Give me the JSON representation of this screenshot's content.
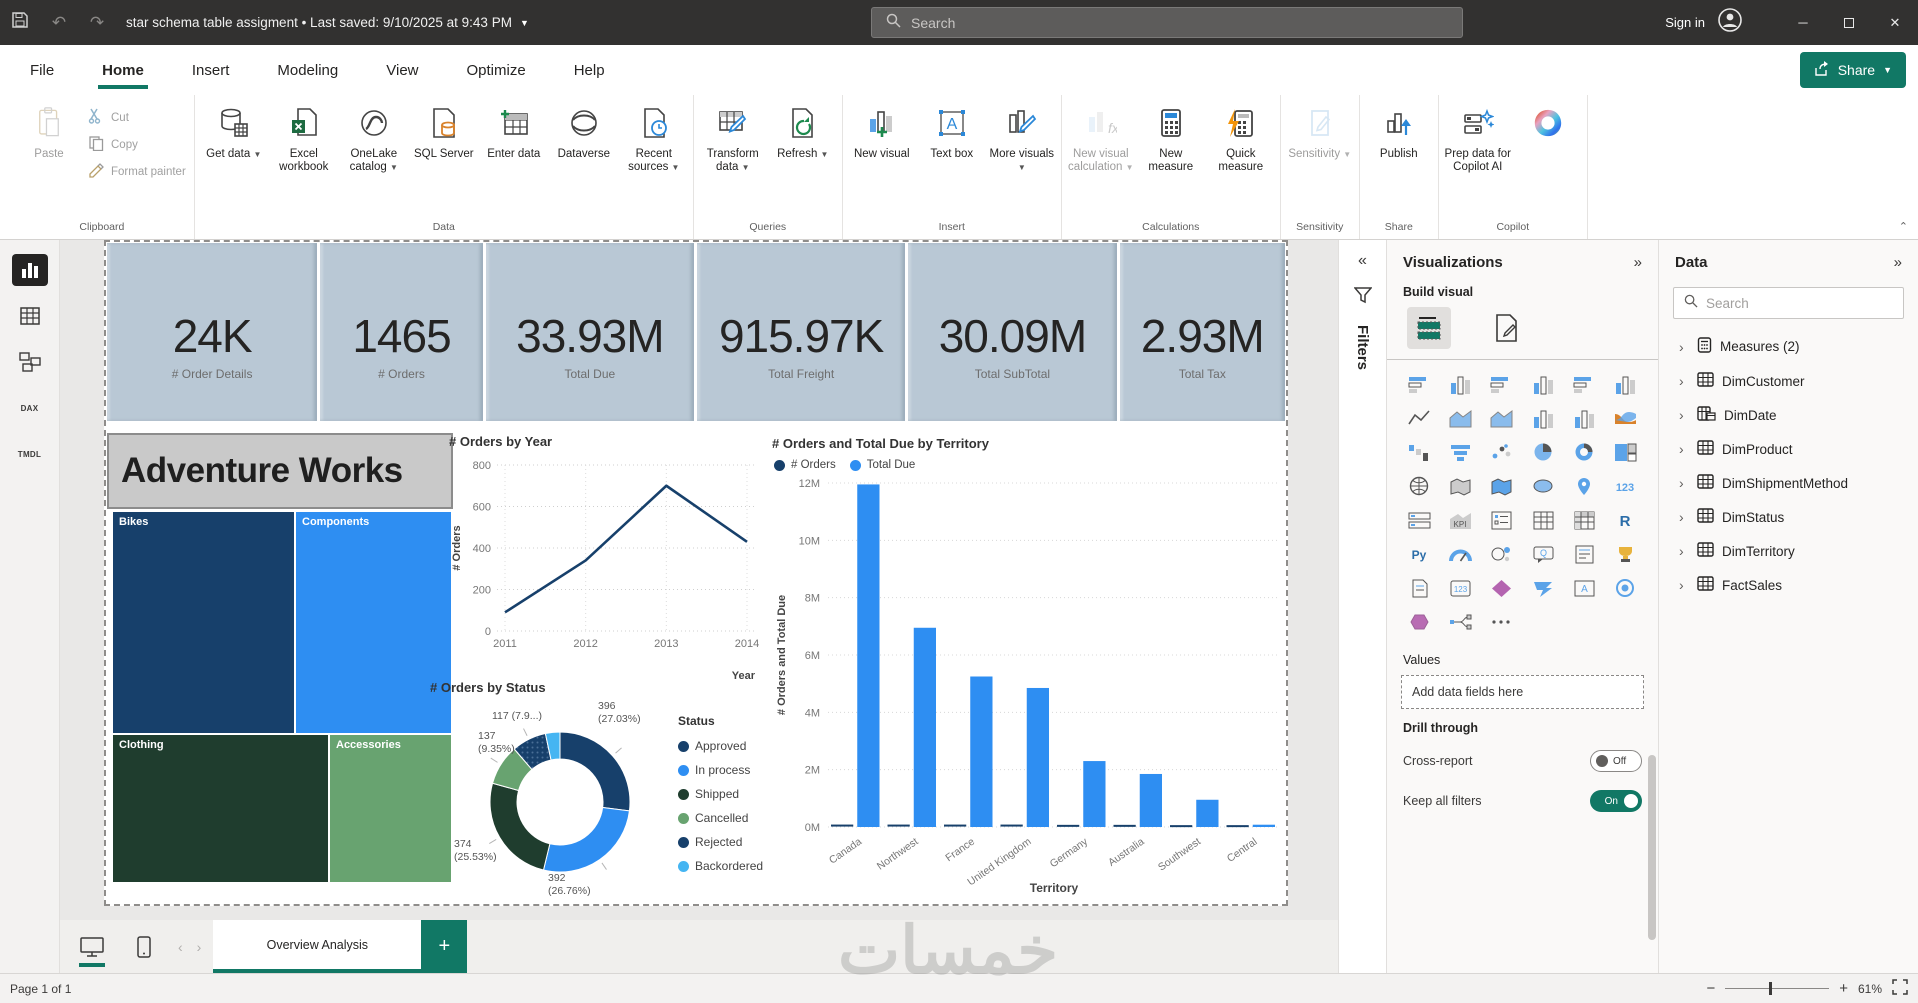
{
  "titlebar": {
    "title": "star schema table assigment  •  Last saved: 9/10/2025 at 9:43 PM",
    "search_placeholder": "Search",
    "sign_in": "Sign in"
  },
  "menubar": {
    "items": [
      "File",
      "Home",
      "Insert",
      "Modeling",
      "View",
      "Optimize",
      "Help"
    ],
    "active": "Home",
    "share_label": "Share"
  },
  "ribbon": {
    "groups": [
      {
        "label": "Clipboard",
        "layout": "clipboard",
        "buttons": [
          {
            "label": "Paste",
            "icon": "paste",
            "disabled": true
          },
          {
            "label": "Cut",
            "icon": "cut",
            "disabled": true
          },
          {
            "label": "Copy",
            "icon": "copy",
            "disabled": true
          },
          {
            "label": "Format painter",
            "icon": "format-painter",
            "disabled": true
          }
        ]
      },
      {
        "label": "Data",
        "buttons": [
          {
            "label": "Get data",
            "icon": "get-data",
            "caret": true
          },
          {
            "label": "Excel workbook",
            "icon": "excel-workbook"
          },
          {
            "label": "OneLake catalog",
            "icon": "onelake-catalog",
            "caret": true
          },
          {
            "label": "SQL Server",
            "icon": "sql-server"
          },
          {
            "label": "Enter data",
            "icon": "enter-data"
          },
          {
            "label": "Dataverse",
            "icon": "dataverse"
          },
          {
            "label": "Recent sources",
            "icon": "recent-sources",
            "caret": true
          }
        ]
      },
      {
        "label": "Queries",
        "buttons": [
          {
            "label": "Transform data",
            "icon": "transform-data",
            "caret": true
          },
          {
            "label": "Refresh",
            "icon": "refresh",
            "caret": true
          }
        ]
      },
      {
        "label": "Insert",
        "buttons": [
          {
            "label": "New visual",
            "icon": "new-visual"
          },
          {
            "label": "Text box",
            "icon": "text-box"
          },
          {
            "label": "More visuals",
            "icon": "more-visuals",
            "caret": true
          }
        ]
      },
      {
        "label": "Calculations",
        "buttons": [
          {
            "label": "New visual calculation",
            "icon": "new-visual-calculation",
            "caret": true,
            "disabled": true
          },
          {
            "label": "New measure",
            "icon": "new-measure"
          },
          {
            "label": "Quick measure",
            "icon": "quick-measure"
          }
        ]
      },
      {
        "label": "Sensitivity",
        "buttons": [
          {
            "label": "Sensitivity",
            "icon": "sensitivity",
            "caret": true,
            "disabled": true
          }
        ]
      },
      {
        "label": "Share",
        "buttons": [
          {
            "label": "Publish",
            "icon": "publish"
          }
        ]
      },
      {
        "label": "Copilot",
        "buttons": [
          {
            "label": "Prep data for Copilot AI",
            "icon": "prep-copilot"
          },
          {
            "label": "",
            "icon": "copilot-logo"
          }
        ]
      }
    ]
  },
  "left_rail": {
    "views": [
      {
        "name": "report-view",
        "active": true
      },
      {
        "name": "table-view",
        "active": false
      },
      {
        "name": "model-view",
        "active": false
      },
      {
        "name": "dax-query-view",
        "text": "DAX",
        "active": false
      },
      {
        "name": "tmdl-view",
        "text": "TMDL",
        "active": false
      }
    ]
  },
  "canvas": {
    "kpi_cards": [
      {
        "value": "24K",
        "label": "# Order Details"
      },
      {
        "value": "1465",
        "label": "# Orders"
      },
      {
        "value": "33.93M",
        "label": "Total Due"
      },
      {
        "value": "915.97K",
        "label": "Total Freight"
      },
      {
        "value": "30.09M",
        "label": "Total SubTotal"
      },
      {
        "value": "2.93M",
        "label": "Total Tax"
      }
    ],
    "adventure_title": "Adventure Works"
  },
  "chart_data": [
    {
      "type": "treemap",
      "title": "",
      "categories": [
        "Bikes",
        "Components",
        "Clothing",
        "Accessories"
      ],
      "estimated_area_pct": [
        33,
        27,
        26,
        14
      ],
      "colors": [
        "#17406b",
        "#2e8ef2",
        "#1f3d2e",
        "#68a370"
      ]
    },
    {
      "type": "line",
      "title": "# Orders by Year",
      "x": [
        2011,
        2012,
        2013,
        2014
      ],
      "values": [
        90,
        340,
        700,
        430
      ],
      "xlabel": "Year",
      "ylabel": "# Orders",
      "ylim": [
        0,
        800
      ],
      "yticks": [
        0,
        200,
        400,
        600,
        800
      ],
      "grid": true,
      "line_color": "#17406b"
    },
    {
      "type": "pie",
      "title": "# Orders by Status",
      "legend_title": "Status",
      "legend_position": "right",
      "categories": [
        "Approved",
        "In process",
        "Shipped",
        "Cancelled",
        "Rejected",
        "Backordered"
      ],
      "values": [
        396,
        392,
        374,
        137,
        117,
        49
      ],
      "labels": [
        "396\n(27.03%)",
        "392\n(26.76%)",
        "374\n(25.53%)",
        "137\n(9.35%)",
        "117 (7.9...)",
        ""
      ],
      "colors": [
        "#17406b",
        "#2e8ef2",
        "#1f3d2e",
        "#68a370",
        "#17406b",
        "#45b5f2"
      ],
      "inner_radius_pct": 60
    },
    {
      "type": "bar",
      "title": "# Orders and Total Due by Territory",
      "categories": [
        "Canada",
        "Northwest",
        "France",
        "United Kingdom",
        "Germany",
        "Australia",
        "Southwest",
        "Central"
      ],
      "series": [
        {
          "name": "# Orders",
          "color": "#17406b",
          "values": [
            0.05,
            0.05,
            0.05,
            0.05,
            0.04,
            0.04,
            0.03,
            0.03
          ]
        },
        {
          "name": "Total Due",
          "color": "#2e8ef2",
          "values": [
            11.95,
            6.95,
            5.25,
            4.85,
            2.3,
            1.85,
            0.95,
            0.08
          ]
        }
      ],
      "xlabel": "Territory",
      "ylabel": "# Orders and Total Due",
      "ylim": [
        0,
        12
      ],
      "ytick_format": "{v}M",
      "grid": true
    }
  ],
  "filters_rail": {
    "label": "Filters"
  },
  "viz_panel": {
    "header": "Visualizations",
    "build_visual": "Build visual",
    "values_label": "Values",
    "add_fields": "Add data fields here",
    "drill_through": "Drill through",
    "cross_report": "Cross-report",
    "cross_report_state": "Off",
    "keep_all_filters": "Keep all filters",
    "keep_all_filters_state": "On",
    "icons": [
      "stacked-bar-chart",
      "stacked-column-chart",
      "clustered-bar-chart",
      "clustered-column-chart",
      "100-stacked-bar-chart",
      "100-stacked-column-chart",
      "line-chart",
      "area-chart",
      "stacked-area-chart",
      "line-and-stacked-column-chart",
      "line-and-clustered-column-chart",
      "ribbon-chart",
      "waterfall-chart",
      "funnel-chart",
      "scatter-chart",
      "pie-chart",
      "donut-chart",
      "treemap-visual",
      "map",
      "filled-map",
      "shape-map",
      "azure-map",
      "arcgis-map",
      "card",
      "multi-row-card",
      "kpi",
      "slicer",
      "table",
      "matrix",
      "r-script-visual",
      "python-visual",
      "gauge",
      "key-influencers",
      "qa-visual",
      "smart-narrative",
      "metrics",
      "paginated-report",
      "visual-calculation",
      "power-apps",
      "power-automate",
      "text-slicer",
      "goals",
      "button-slicer",
      "decomposition-tree",
      "get-more-visuals"
    ]
  },
  "data_panel": {
    "header": "Data",
    "search_placeholder": "Search",
    "fields": [
      {
        "label": "Measures (2)",
        "icon": "calculator-icon"
      },
      {
        "label": "DimCustomer",
        "icon": "table-icon"
      },
      {
        "label": "DimDate",
        "icon": "table-calendar-icon"
      },
      {
        "label": "DimProduct",
        "icon": "table-icon"
      },
      {
        "label": "DimShipmentMethod",
        "icon": "table-icon"
      },
      {
        "label": "DimStatus",
        "icon": "table-icon"
      },
      {
        "label": "DimTerritory",
        "icon": "table-icon"
      },
      {
        "label": "FactSales",
        "icon": "table-icon"
      }
    ]
  },
  "tabbar": {
    "tab": "Overview Analysis"
  },
  "statusbar": {
    "page_indicator": "Page 1 of 1",
    "zoom": "61%"
  },
  "watermark": "خمسات",
  "colors": {
    "accent_green": "#117865",
    "navy": "#17406b",
    "blue": "#2e8ef2",
    "dark_green": "#1f3d2e",
    "green": "#68a370",
    "light_blue": "#45b5f2",
    "card_bg": "#b9c8d5"
  }
}
